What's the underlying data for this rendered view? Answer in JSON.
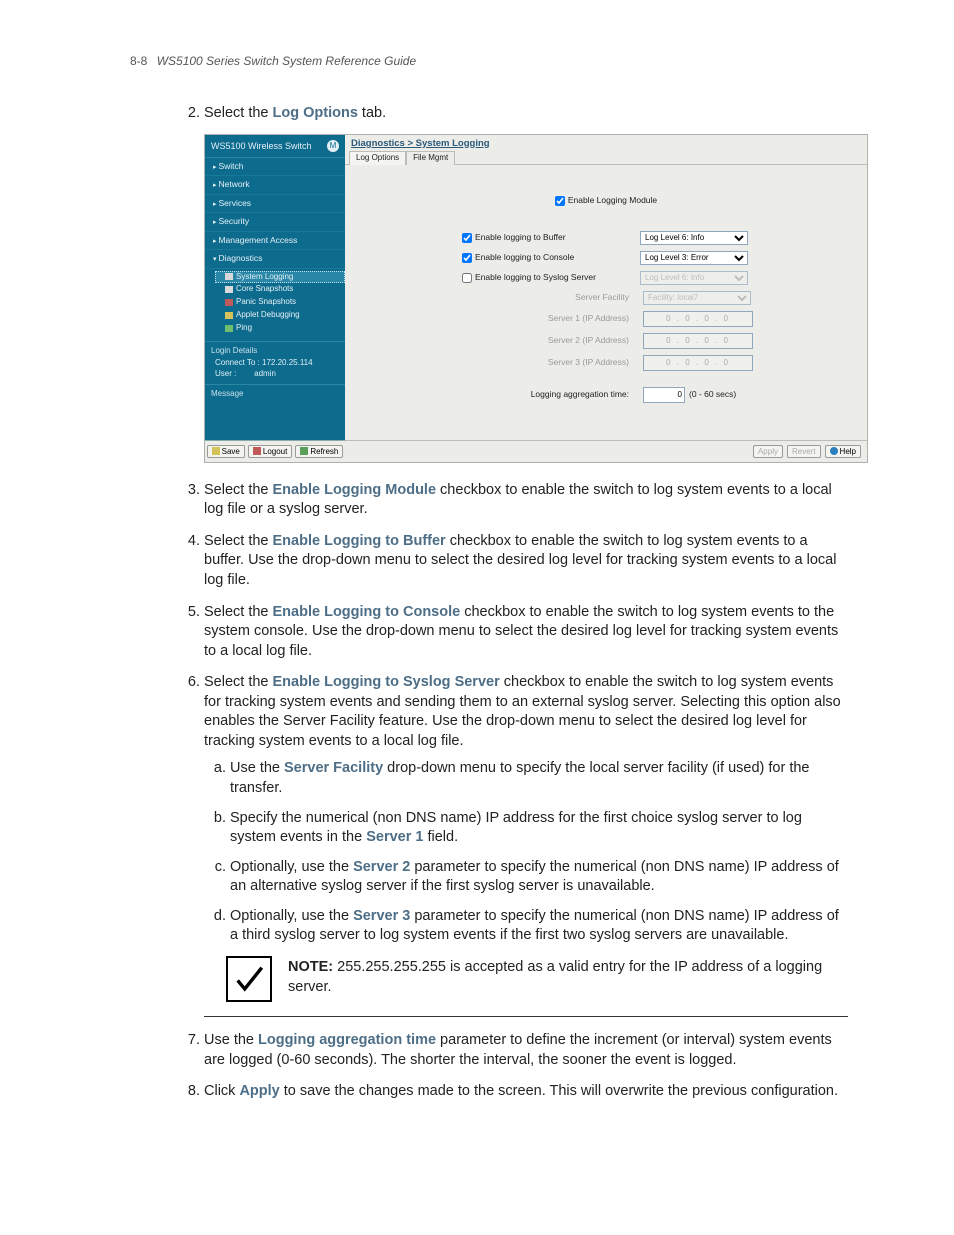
{
  "page_header": {
    "page_num": "8-8",
    "title": "WS5100 Series Switch System Reference Guide"
  },
  "steps": {
    "s2": {
      "pre": "Select the ",
      "b": "Log Options",
      "post": " tab."
    },
    "s3": {
      "pre": "Select the ",
      "b": "Enable Logging Module",
      "post": " checkbox to enable the switch to log system events to a local log file or a syslog server."
    },
    "s4": {
      "pre": "Select the ",
      "b": "Enable Logging to Buffer",
      "post": " checkbox to enable the switch to log system events to a buffer. Use the drop-down menu to select the desired log level for tracking system events to a local log file."
    },
    "s5": {
      "pre": "Select the ",
      "b": "Enable Logging to Console",
      "post": " checkbox to enable the switch to log system events to the system console. Use the drop-down menu to select the desired log level for tracking system events to a local log file."
    },
    "s6": {
      "pre": "Select the ",
      "b": "Enable Logging to Syslog Server",
      "post": " checkbox to enable the switch to log system events for tracking system events and sending them to an external syslog server. Selecting this option also enables the Server Facility feature. Use the drop-down menu to select the desired log level for tracking system events to a local log file."
    },
    "s6a": {
      "pre": "Use the ",
      "b": "Server Facility",
      "post": " drop-down menu to specify the local server facility (if used) for the transfer."
    },
    "s6b": {
      "pre": "Specify the numerical (non DNS name) IP address for the first choice syslog server to log system events in the ",
      "b": "Server 1",
      "post": " field."
    },
    "s6c": {
      "pre": "Optionally, use the ",
      "b": "Server 2",
      "post": " parameter to specify the numerical (non DNS name) IP address of an alternative syslog server if the first syslog server is unavailable."
    },
    "s6d": {
      "pre": "Optionally, use the ",
      "b": "Server 3",
      "post": " parameter to specify the numerical (non DNS name) IP address of a third syslog server to log system events if the first two syslog servers are unavailable."
    },
    "s7": {
      "pre": "Use the ",
      "b": "Logging aggregation time",
      "post": " parameter to define the increment (or interval) system events are logged (0-60 seconds). The shorter the interval, the sooner the event is logged."
    },
    "s8": {
      "pre": "Click ",
      "b": "Apply",
      "post": " to save the changes made to the screen. This will overwrite the previous configuration."
    }
  },
  "note": {
    "label": "NOTE:",
    "text": " 255.255.255.255 is accepted as a valid entry for the IP address of a logging server."
  },
  "ui": {
    "brand": "WS5100 Wireless Switch",
    "nav": {
      "switch": "Switch",
      "network": "Network",
      "services": "Services",
      "security": "Security",
      "mgmt": "Management Access",
      "diag": "Diagnostics"
    },
    "tree": {
      "syslog": "System Logging",
      "core": "Core Snapshots",
      "panic": "Panic Snapshots",
      "applet": "Applet Debugging",
      "ping": "Ping"
    },
    "login_title": "Login Details",
    "login_connect_label": "Connect To :",
    "login_connect": "172.20.25.114",
    "login_user_label": "User :",
    "login_user": "admin",
    "message_title": "Message",
    "btn_save": "Save",
    "btn_logout": "Logout",
    "btn_refresh": "Refresh",
    "crumb": "Diagnostics > System Logging",
    "tab_log": "Log Options",
    "tab_file": "File Mgmt",
    "chk_module": "Enable Logging Module",
    "chk_buffer": "Enable logging to Buffer",
    "chk_console": "Enable logging to Console",
    "chk_syslog": "Enable logging to Syslog Server",
    "lvl_buffer": "Log Level 6: Info",
    "lvl_console": "Log Level 3: Error",
    "lvl_syslog": "Log Level 6: Info",
    "lbl_facility": "Server Facility",
    "val_facility": "Facility: local7",
    "lbl_srv1": "Server 1 (IP Address)",
    "lbl_srv2": "Server 2 (IP Address)",
    "lbl_srv3": "Server 3 (IP Address)",
    "ip_blank": "0 . 0 . 0 . 0",
    "lbl_agg": "Logging aggregation time:",
    "val_agg": "0",
    "agg_hint": "(0 - 60 secs)",
    "btn_apply": "Apply",
    "btn_revert": "Revert",
    "btn_help": "Help"
  }
}
